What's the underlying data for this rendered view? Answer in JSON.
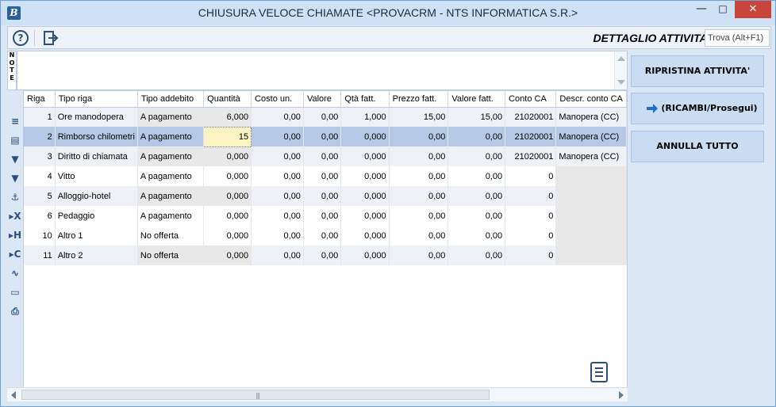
{
  "window": {
    "title": "CHIUSURA VELOCE CHIAMATE <PROVACRM - NTS INFORMATICA S.R.>",
    "app_icon": "B",
    "minimize": "—",
    "maximize": "□",
    "close": "✕"
  },
  "toolbar": {
    "help_icon": "question-icon",
    "help_glyph": "?",
    "exit_icon": "exit-icon",
    "section_title": "DETTAGLIO ATTIVITA'",
    "find_label": "Trova (Alt+F1)"
  },
  "note": {
    "label": "NOTE",
    "letters": [
      "N",
      "O",
      "T",
      "E"
    ]
  },
  "sidebar_icons": [
    "list-icon",
    "table-icon",
    "filter-icon",
    "filter-clear-icon",
    "anchor-icon",
    "expand-x-icon",
    "expand-h-icon",
    "expand-c-icon",
    "chart-icon",
    "monitor-icon",
    "print-icon"
  ],
  "sidebar_glyphs": [
    "≡",
    "▤",
    "▼",
    "▼",
    "⚓",
    "▸X",
    "▸H",
    "▸C",
    "∿",
    "▭",
    "⎙"
  ],
  "grid": {
    "columns": [
      "Riga",
      "Tipo riga",
      "Tipo addebito",
      "Quantità",
      "Costo un.",
      "Valore",
      "Qtà fatt.",
      "Prezzo fatt.",
      "Valore fatt.",
      "Conto CA",
      "Descr. conto CA"
    ],
    "rows": [
      {
        "riga": "1",
        "tipo_riga": "Ore manodopera",
        "tipo_addebito": "A pagamento",
        "quantita": "6,000",
        "costo_un": "0,00",
        "valore": "0,00",
        "qta_fatt": "1,000",
        "prezzo_fatt": "15,00",
        "valore_fatt": "15,00",
        "conto_ca": "21020001",
        "descr_conto": "Manopera (CC)"
      },
      {
        "riga": "2",
        "tipo_riga": "Rimborso chilometri",
        "tipo_addebito": "A pagamento",
        "quantita": "15",
        "costo_un": "0,00",
        "valore": "0,00",
        "qta_fatt": "0,000",
        "prezzo_fatt": "0,00",
        "valore_fatt": "0,00",
        "conto_ca": "21020001",
        "descr_conto": "Manopera (CC)"
      },
      {
        "riga": "3",
        "tipo_riga": "Diritto di chiamata",
        "tipo_addebito": "A pagamento",
        "quantita": "0,000",
        "costo_un": "0,00",
        "valore": "0,00",
        "qta_fatt": "0,000",
        "prezzo_fatt": "0,00",
        "valore_fatt": "0,00",
        "conto_ca": "21020001",
        "descr_conto": "Manopera (CC)"
      },
      {
        "riga": "4",
        "tipo_riga": "Vitto",
        "tipo_addebito": "A pagamento",
        "quantita": "0,000",
        "costo_un": "0,00",
        "valore": "0,00",
        "qta_fatt": "0,000",
        "prezzo_fatt": "0,00",
        "valore_fatt": "0,00",
        "conto_ca": "0",
        "descr_conto": ""
      },
      {
        "riga": "5",
        "tipo_riga": "Alloggio-hotel",
        "tipo_addebito": "A pagamento",
        "quantita": "0,000",
        "costo_un": "0,00",
        "valore": "0,00",
        "qta_fatt": "0,000",
        "prezzo_fatt": "0,00",
        "valore_fatt": "0,00",
        "conto_ca": "0",
        "descr_conto": ""
      },
      {
        "riga": "6",
        "tipo_riga": "Pedaggio",
        "tipo_addebito": "A pagamento",
        "quantita": "0,000",
        "costo_un": "0,00",
        "valore": "0,00",
        "qta_fatt": "0,000",
        "prezzo_fatt": "0,00",
        "valore_fatt": "0,00",
        "conto_ca": "0",
        "descr_conto": ""
      },
      {
        "riga": "10",
        "tipo_riga": "Altro 1",
        "tipo_addebito": "No offerta",
        "quantita": "0,000",
        "costo_un": "0,00",
        "valore": "0,00",
        "qta_fatt": "0,000",
        "prezzo_fatt": "0,00",
        "valore_fatt": "0,00",
        "conto_ca": "0",
        "descr_conto": ""
      },
      {
        "riga": "11",
        "tipo_riga": "Altro 2",
        "tipo_addebito": "No offerta",
        "quantita": "0,000",
        "costo_un": "0,00",
        "valore": "0,00",
        "qta_fatt": "0,000",
        "prezzo_fatt": "0,00",
        "valore_fatt": "0,00",
        "conto_ca": "0",
        "descr_conto": ""
      }
    ],
    "selected_row": "2",
    "doc_icon": "document-list-icon",
    "scroll_grip": "|||"
  },
  "side_panel": {
    "ripristina_label": "RIPRISTINA ATTIVITA'",
    "prosegui_label": "(RICAMBI/Prosegui)",
    "prosegui_icon": "arrow-right-icon",
    "annulla_label": "ANNULLA TUTTO"
  },
  "colors": {
    "accent": "#2c4f7c",
    "selection": "#b5c9e6",
    "edit_cell": "#fcf3c2",
    "close_button": "#c7453a",
    "panel_button": "#c9dcf2"
  }
}
